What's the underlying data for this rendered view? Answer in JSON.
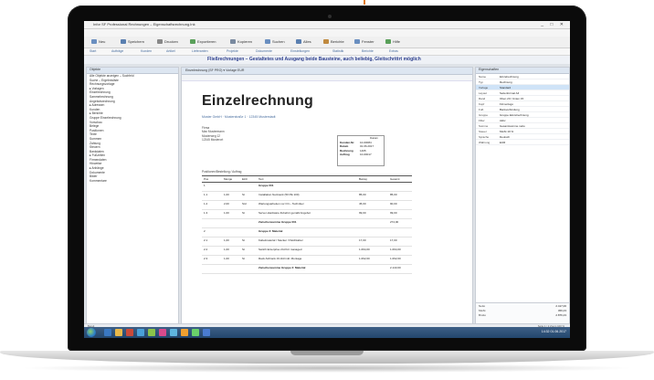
{
  "app": {
    "window_title": "Infor SF Professional Rechnungen – Eigenschaftsrechnung.Ink",
    "window_controls": "_ □ ✕"
  },
  "toolbar": {
    "items": [
      "Neu",
      "Speichern",
      "Drucken",
      "Exportieren",
      "Kopieren",
      "Suchen",
      "Alles",
      "Berichte",
      "Fenster",
      "Hilfe"
    ]
  },
  "linkbar": {
    "items": [
      "Start",
      "Aufträge",
      "Kunden",
      "Artikel",
      "Lieferanten",
      "Projekte",
      "Dokumente",
      "Einstellungen",
      "Statistik",
      "Berichte",
      "Extras"
    ]
  },
  "banner": {
    "text": "Fließrechnungen – Gestaltetes und Ausgang beide Bausteine, auch beliebig, Gleitschrittrt möglich"
  },
  "left_panel": {
    "header": "Objekte",
    "rows": [
      "Alle Objekte anzeigen – Suchfeld",
      "Suche – Ergebnisliste",
      "Rechnungsvorlage",
      "▸ Vorlagen",
      "   Einzelrechnung",
      "   Sammelrechnung",
      "   Angebotsrechnung",
      "▸ Adressen",
      "   Kunden",
      "▸ Berichte",
      "   Gruppe Einzelrechnung",
      "   Vorschau",
      "   Belege",
      "   Positionen",
      "   Texte",
      "   Summen",
      "   Zahlung",
      "   Steuern",
      "   Bankdaten",
      "▸ Fußzeilen",
      "   Firmendaten",
      "   Hinweise",
      "▸ Anhänge",
      "   Dokumente",
      "   Bilder",
      "   Kommentare"
    ]
  },
  "center": {
    "tab": "Einzelrechnung (SF PRO) ▾  Vorlage EUR",
    "doc_title": "Einzelrechnung",
    "doc_subtitle": "Muster GmbH · Musterstraße 1 · 12345 Musterstadt",
    "address_lines": [
      "Firma",
      "Max Mustermann",
      "Musterweg 12",
      "12345 Musterort"
    ],
    "info_header": "Datum",
    "info_rows": [
      {
        "k": "Kunden-Nr.",
        "v": "10-00084"
      },
      {
        "k": "Datum",
        "v": "01.06.2017"
      },
      {
        "k": "Rechnung",
        "v": "1405"
      },
      {
        "k": "Auftrag",
        "v": "10-00017"
      }
    ],
    "table_label": "Positionen/Bestellung / Auftrag",
    "columns": [
      "Pos",
      "Menge",
      "Einh",
      "Text",
      "Betrag",
      "Gesamt"
    ],
    "rows": [
      {
        "pos": "1",
        "qty": "",
        "unit": "",
        "text": "Gruppe 001",
        "amt": "",
        "total": ""
      },
      {
        "pos": "1.1",
        "qty": "1,00",
        "unit": "St",
        "text": "Installation Netzwerk (50 PE 100)",
        "amt": "85,00",
        "total": "85,00"
      },
      {
        "pos": "1.2",
        "qty": "2,00",
        "unit": "Std",
        "text": "Wartungsarbeiten vor Ort – Techniker",
        "amt": "45,00",
        "total": "90,00"
      },
      {
        "pos": "1.3",
        "qty": "1,00",
        "unit": "St",
        "text": "Server-Hardware Zubehör gemäß Angebot",
        "amt": "99,00",
        "total": "99,00"
      },
      {
        "pos": "",
        "qty": "",
        "unit": "",
        "text": "Zwischensumme Gruppe 001",
        "amt": "",
        "total": "274,00"
      },
      {
        "pos": "2",
        "qty": "",
        "unit": "",
        "text": "Gruppe 2: Material",
        "amt": "",
        "total": ""
      },
      {
        "pos": "2.1",
        "qty": "1,00",
        "unit": "St",
        "text": "Kabelmaterial / Stecker / Patchkabel",
        "amt": "17,00",
        "total": "17,00"
      },
      {
        "pos": "2.2",
        "qty": "1,00",
        "unit": "St",
        "text": "Switch Enterprise 24-Port managed",
        "amt": "1.064,00",
        "total": "1.064,00"
      },
      {
        "pos": "2.3",
        "qty": "1,00",
        "unit": "St",
        "text": "Rack-Schrank 19 Zoll inkl. Montage",
        "amt": "1.062,00",
        "total": "1.062,00"
      },
      {
        "pos": "",
        "qty": "",
        "unit": "",
        "text": "Zwischensumme Gruppe 2: Material",
        "amt": "",
        "total": "2.143,00"
      }
    ]
  },
  "right_panel": {
    "header": "Eigenschaften",
    "rows": [
      {
        "k": "Name",
        "v": "Einzelrechnung"
      },
      {
        "k": "Typ",
        "v": "Rechnung"
      },
      {
        "k": "Vorlage",
        "v": "Standard"
      },
      {
        "k": "Layout",
        "v": "Seitenformat A4"
      },
      {
        "k": "Rand",
        "v": "Oben 20 / Unten 15"
      },
      {
        "k": "Kopf",
        "v": "Firmenlogo"
      },
      {
        "k": "Fuß",
        "v": "Bankverbindung"
      },
      {
        "k": "Gruppe",
        "v": "Gruppe Einzelrechnung"
      },
      {
        "k": "Filter",
        "v": "Aktiv"
      },
      {
        "k": "Summe",
        "v": "Gesamtsumme netto"
      },
      {
        "k": "Steuer",
        "v": "MwSt 19 %"
      },
      {
        "k": "Sprache",
        "v": "Deutsch"
      },
      {
        "k": "Währung",
        "v": "EUR"
      }
    ],
    "selected_index": 2,
    "footer": [
      {
        "k": "Netto",
        "v": "2.417,00"
      },
      {
        "k": "MwSt",
        "v": "459,23"
      },
      {
        "k": "Brutto",
        "v": "2.876,23"
      }
    ]
  },
  "statusbar": {
    "left": "Bereit",
    "right": "Seite 1 / 2   Zoom 100 %"
  },
  "taskbar": {
    "clock": "14:32  01.06.2017"
  },
  "colors": {
    "banner_text": "#2a3c8c",
    "accent": "#4a6fa0",
    "taskbar": "#2c4f78",
    "highlight": "#e07b20"
  }
}
